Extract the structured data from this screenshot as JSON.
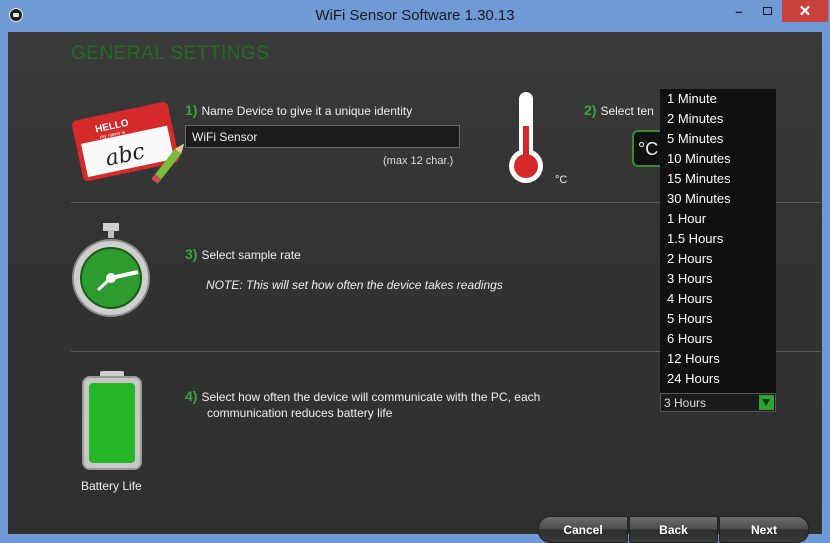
{
  "window": {
    "title": "WiFi Sensor Software 1.30.13",
    "minimize": "–",
    "close": "✕"
  },
  "page": {
    "heading": "GENERAL SETTINGS"
  },
  "step1": {
    "number": "1)",
    "label": "Name Device to give it a unique identity",
    "name_value": "WiFi Sensor",
    "hint": "(max 12 char.)"
  },
  "step2": {
    "number": "2)",
    "label": "Select ten",
    "unit_label": "°C",
    "unit_value": "°C"
  },
  "step3": {
    "number": "3)",
    "label": "Select sample rate",
    "note": "NOTE: This will set how often the device takes readings"
  },
  "step4": {
    "number": "4)",
    "label_line1": "Select how often the device will communicate with the PC, each",
    "label_line2": "communication reduces battery life",
    "selected": "3 Hours"
  },
  "dropdown_options": [
    "1 Minute",
    "2 Minutes",
    "5 Minutes",
    "10 Minutes",
    "15 Minutes",
    "30 Minutes",
    "1 Hour",
    "1.5 Hours",
    "2 Hours",
    "3 Hours",
    "4 Hours",
    "5 Hours",
    "6 Hours",
    "12 Hours",
    "24 Hours"
  ],
  "illustrations": {
    "name_tag": {
      "top": "HELLO",
      "sub": "my name is",
      "text": "abc"
    },
    "battery_label": "Battery Life"
  },
  "footer": {
    "cancel": "Cancel",
    "back": "Back",
    "next": "Next"
  },
  "colors": {
    "accent_green": "#3aa53a",
    "heading_green": "#1f6e1f",
    "close_red": "#c8413a",
    "titlebar_blue": "#6f9ad6"
  }
}
